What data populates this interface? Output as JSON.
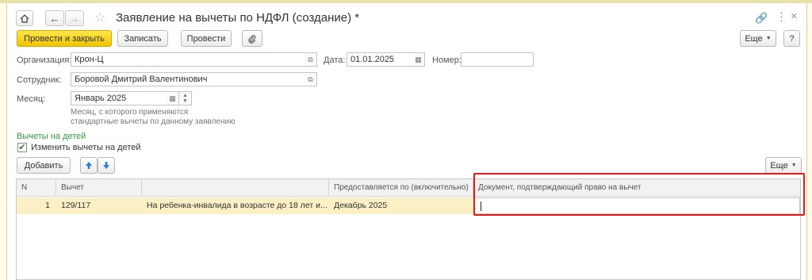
{
  "window": {
    "title": "Заявление на вычеты по НДФЛ (создание) *"
  },
  "toolbar": {
    "post_and_close": "Провести и закрыть",
    "save": "Записать",
    "post": "Провести",
    "more": "Еще",
    "help": "?"
  },
  "form": {
    "organization_label": "Организация:",
    "organization_value": "Крон-Ц",
    "date_label": "Дата:",
    "date_value": "01.01.2025",
    "number_label": "Номер:",
    "number_value": "",
    "employee_label": "Сотрудник:",
    "employee_value": "Боровой Дмитрий Валентинович",
    "month_label": "Месяц:",
    "month_value": "Январь 2025",
    "month_hint_line1": "Месяц, с которого применяются",
    "month_hint_line2": "стандартные вычеты по данному заявлению"
  },
  "children": {
    "section_title": "Вычеты на детей",
    "change_checkbox_label": "Изменить вычеты на детей",
    "change_checked": true,
    "add_button": "Добавить",
    "more_button": "Еще"
  },
  "table": {
    "columns": [
      "N",
      "Вычет",
      "",
      "Предоставляется по (включительно)",
      "Документ, подтверждающий право на вычет"
    ],
    "rows": [
      {
        "n": "1",
        "code": "129/117",
        "description": "На ребенка-инвалида в возрасте до 18 лет и...",
        "until": "Декабрь 2025",
        "document": ""
      }
    ]
  }
}
